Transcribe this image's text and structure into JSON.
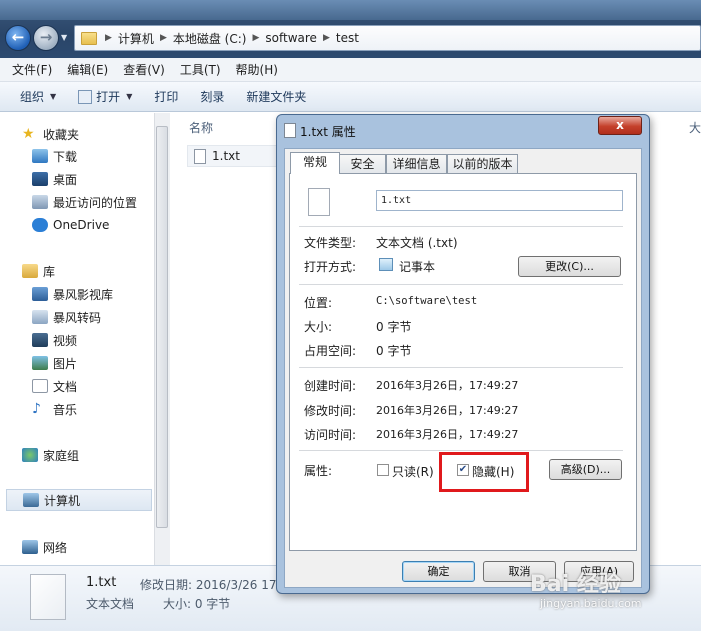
{
  "address": {
    "segments": [
      "计算机",
      "本地磁盘 (C:)",
      "software",
      "test"
    ]
  },
  "menu": [
    "文件(F)",
    "编辑(E)",
    "查看(V)",
    "工具(T)",
    "帮助(H)"
  ],
  "toolbar": {
    "organize": "组织",
    "open": "打开",
    "print": "打印",
    "burn": "刻录",
    "new_folder": "新建文件夹"
  },
  "sidebar": {
    "favorites": "收藏夹",
    "downloads": "下载",
    "desktop": "桌面",
    "recent": "最近访问的位置",
    "onedrive": "OneDrive",
    "library": "库",
    "lib1": "暴风影视库",
    "lib2": "暴风转码",
    "videos": "视频",
    "pictures": "图片",
    "documents": "文档",
    "music": "音乐",
    "homegroup": "家庭组",
    "computer": "计算机",
    "network": "网络"
  },
  "main": {
    "col_name": "名称",
    "col_size": "大",
    "file": "1.txt"
  },
  "details": {
    "name": "1.txt",
    "modified": "修改日期: 2016/3/26 17",
    "type": "文本文档",
    "size": "大小: 0 字节"
  },
  "dialog": {
    "title": "1.txt 属性",
    "close": "x",
    "tabs": [
      "常规",
      "安全",
      "详细信息",
      "以前的版本"
    ],
    "filename": "1.txt",
    "type_label": "文件类型:",
    "type_value": "文本文档 (.txt)",
    "open_label": "打开方式:",
    "open_value": "记事本",
    "change_button": "更改(C)...",
    "location_label": "位置:",
    "location_value": "C:\\software\\test",
    "size_label": "大小:",
    "size_value": "0 字节",
    "disk_label": "占用空间:",
    "disk_value": "0 字节",
    "created_label": "创建时间:",
    "created_value": "2016年3月26日，17:49:27",
    "modified_label": "修改时间:",
    "modified_value": "2016年3月26日，17:49:27",
    "accessed_label": "访问时间:",
    "accessed_value": "2016年3月26日，17:49:27",
    "attr_label": "属性:",
    "readonly": "只读(R)",
    "hidden": "隐藏(H)",
    "advanced": "高级(D)...",
    "readonly_checked": false,
    "hidden_checked": true,
    "ok": "确定",
    "cancel": "取消",
    "apply": "应用(A)"
  },
  "watermark": {
    "brand": "Bai 经验",
    "url": "jingyan.baidu.com"
  },
  "colors": {
    "highlight_box": "#e0191c",
    "title_bar": "#a9c2de"
  }
}
